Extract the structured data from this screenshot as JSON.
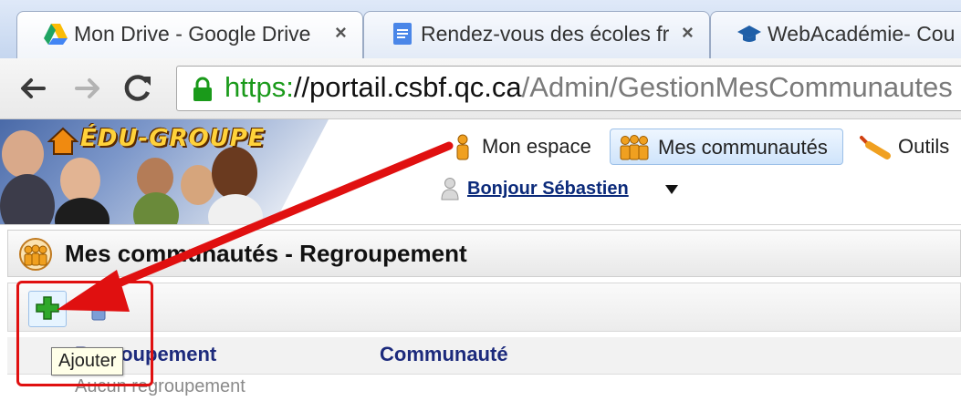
{
  "browser": {
    "tabs": [
      {
        "title": "Mon Drive - Google Drive",
        "icon": "google-drive-icon",
        "close": "×"
      },
      {
        "title": "Rendez-vous des écoles fr",
        "icon": "google-docs-icon",
        "close": "×"
      },
      {
        "title": "WebAcadémie- Cou",
        "icon": "graduation-cap-icon"
      }
    ],
    "url": {
      "scheme": "https:",
      "host": "//portail.csbf.qc.ca",
      "path": "/Admin/GestionMesCommunautes"
    }
  },
  "header": {
    "logo": "ÉDU-GROUPE",
    "nav": {
      "mon_espace": "Mon espace",
      "mes_communautes": "Mes communautés",
      "outils": "Outils"
    },
    "greeting": "Bonjour Sébastien"
  },
  "page": {
    "title": "Mes communautés - Regroupement",
    "tooltip": "Ajouter",
    "table": {
      "columns": [
        "Regroupement",
        "Communauté"
      ],
      "empty_text": "Aucun regroupement"
    }
  },
  "colors": {
    "highlight": "#e01010",
    "link": "#0b2a7a",
    "add_icon": "#2fa82a"
  }
}
